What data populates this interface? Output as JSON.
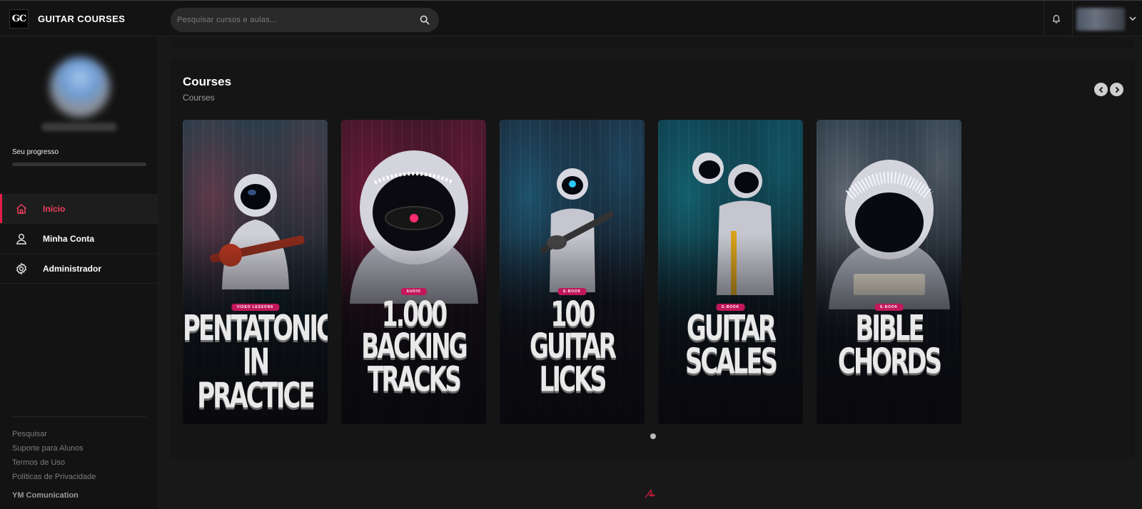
{
  "header": {
    "logo_text": "GC",
    "brand": "GUITAR COURSES",
    "search_placeholder": "Pesquisar cursos e aulas..."
  },
  "sidebar": {
    "progress_label": "Seu progresso",
    "progress_value": 0,
    "nav": [
      {
        "label": "Início",
        "icon": "home-icon",
        "active": true
      },
      {
        "label": "Minha Conta",
        "icon": "user-icon",
        "active": false
      },
      {
        "label": "Administrador",
        "icon": "gear-icon",
        "active": false
      }
    ],
    "footer_links": [
      "Pesquisar",
      "Suporte para Alunos",
      "Termos de Uso",
      "Políticas de Privacidade"
    ],
    "company": "YM Comunication"
  },
  "main": {
    "section_title": "Courses",
    "section_subtitle": "Courses",
    "cards": [
      {
        "badge": "VIDEO LESSONS",
        "title_lines": [
          "PENTATONIC",
          "IN PRACTICE"
        ],
        "accent": "#ff4d6d",
        "bg": "#0f3b44"
      },
      {
        "badge": "AUDIO",
        "title_lines": [
          "1.000",
          "BACKING",
          "TRACKS"
        ],
        "accent": "#ff2d6f",
        "bg": "#2b1420"
      },
      {
        "badge": "E-BOOK",
        "title_lines": [
          "100",
          "GUITAR",
          "LICKS"
        ],
        "accent": "#2cc7ff",
        "bg": "#1a1c2a"
      },
      {
        "badge": "E-BOOK",
        "title_lines": [
          "GUITAR",
          "SCALES"
        ],
        "accent": "#1fd1e0",
        "bg": "#0e2f3e"
      },
      {
        "badge": "E-BOOK",
        "title_lines": [
          "BIBLE",
          "CHORDS"
        ],
        "accent": "#f5f5ff",
        "bg": "#162734"
      }
    ]
  }
}
